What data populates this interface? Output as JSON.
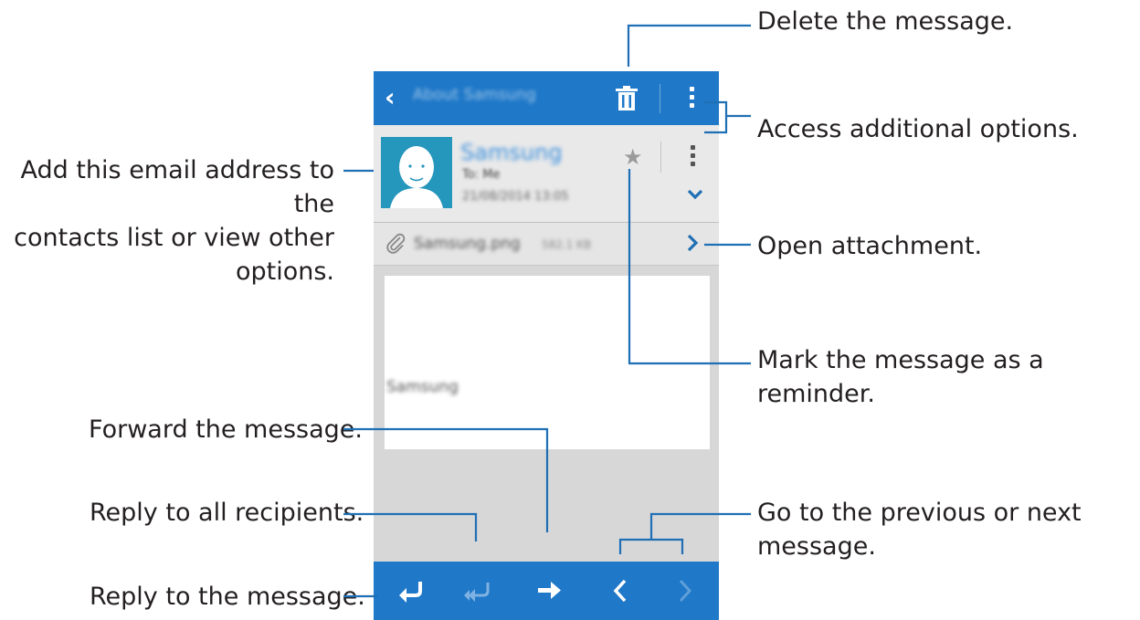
{
  "callouts": {
    "delete": "Delete the message.",
    "more_options": "Access additional options.",
    "contact": [
      "Add this email address to the",
      "contacts list or view other",
      "options."
    ],
    "open_attachment": "Open attachment.",
    "reminder": "Mark the message as a reminder.",
    "forward": "Forward the message.",
    "reply_all": "Reply to all recipients.",
    "reply": "Reply to the message.",
    "prev_next": [
      "Go to the previous or next",
      "message."
    ]
  },
  "email": {
    "folder_title": "About Samsung",
    "sender": "Samsung",
    "to": "To: Me",
    "date": "21/08/2014 13:05",
    "attachment_name": "Samsung.png",
    "attachment_size": "582.1 KB",
    "body": "Samsung"
  },
  "colors": {
    "accent": "#1f78c8",
    "line": "#1f6fb5",
    "avatar": "#2596bc"
  },
  "icons": {
    "back": "chevron-left",
    "delete": "trash",
    "more": "kebab-vertical",
    "favorite": "star",
    "expand": "chevron-down",
    "attachment": "paperclip",
    "open": "chevron-right",
    "reply": "reply-arrow",
    "reply_all": "reply-all-arrow",
    "forward": "arrow-right",
    "previous": "chevron-left",
    "next": "chevron-right"
  }
}
